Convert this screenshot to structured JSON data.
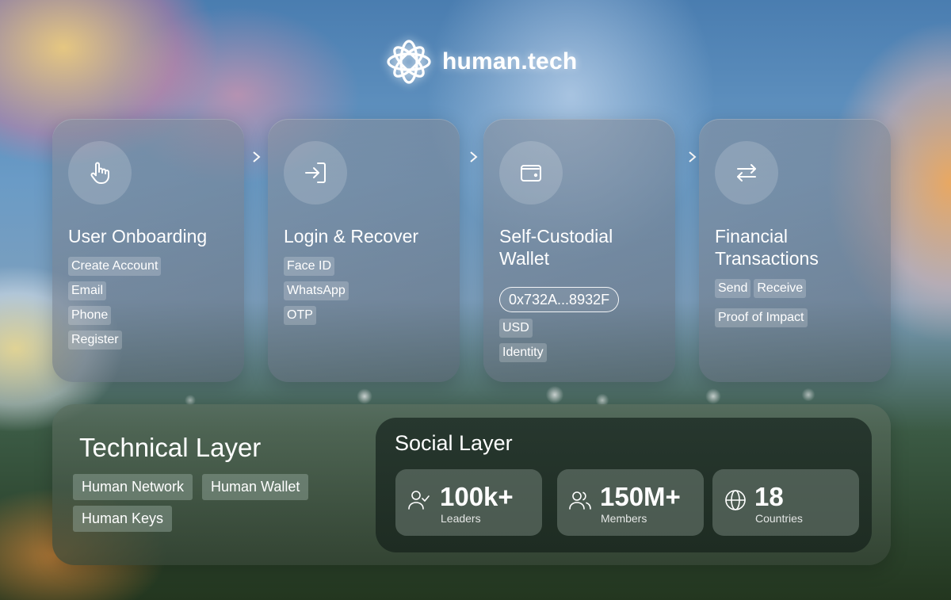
{
  "brand": {
    "name": "human.tech"
  },
  "cards": [
    {
      "title": "User Onboarding",
      "icon": "hand-pointer-icon",
      "tags": [
        "Create Account",
        "Email",
        "Phone",
        "Register"
      ]
    },
    {
      "title": "Login & Recover",
      "icon": "login-icon",
      "tags": [
        "Face ID",
        "WhatsApp",
        "OTP"
      ]
    },
    {
      "title": "Self-Custodial Wallet",
      "title_line1": "Self-Custodial",
      "title_line2": "Wallet",
      "icon": "wallet-icon",
      "address": "0x732A...8932F",
      "tags": [
        "USD",
        "Identity"
      ]
    },
    {
      "title": "Financial Transactions",
      "title_line1": "Financial",
      "title_line2": "Transactions",
      "icon": "swap-arrows-icon",
      "tags": [
        "Send",
        "Receive",
        "Proof of Impact"
      ]
    }
  ],
  "technical_layer": {
    "title": "Technical Layer",
    "tags": [
      "Human Network",
      "Human Wallet",
      "Human Keys"
    ]
  },
  "social_layer": {
    "title": "Social Layer",
    "stats": [
      {
        "value": "100k+",
        "label": "Leaders",
        "icon": "user-check-icon"
      },
      {
        "value": "150M+",
        "label": "Members",
        "icon": "users-icon"
      },
      {
        "value": "18",
        "label": "Countries",
        "icon": "globe-icon"
      }
    ]
  }
}
